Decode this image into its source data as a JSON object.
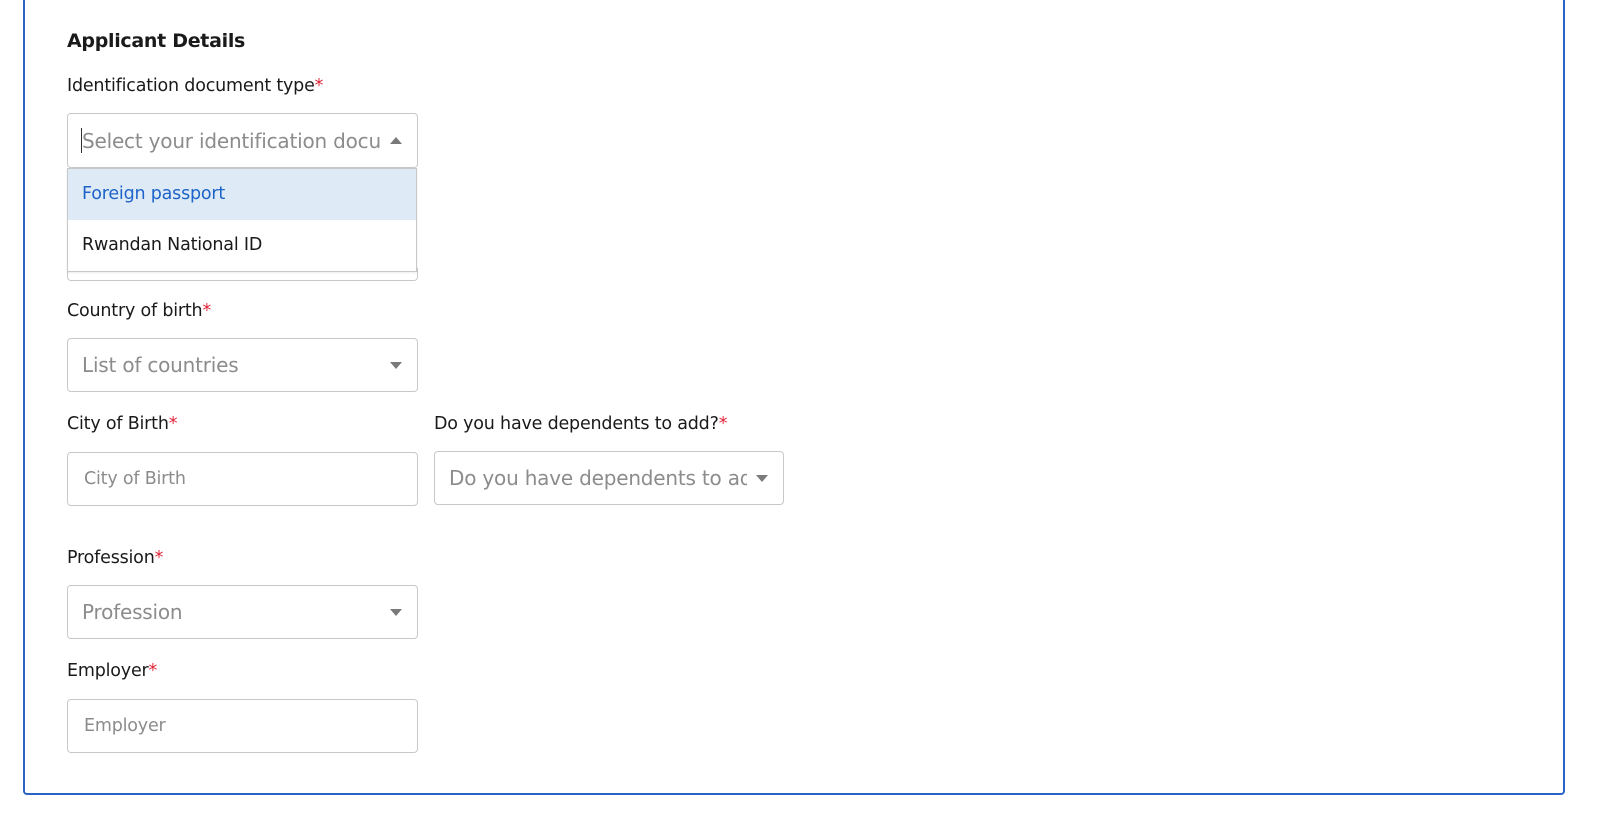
{
  "section": {
    "title": "Applicant Details"
  },
  "required_marker": "*",
  "id_doc": {
    "label": "Identification document type",
    "placeholder": "Select your identification docur",
    "options": [
      "Foreign passport",
      "Rwandan National ID"
    ],
    "highlighted_option": "Foreign passport"
  },
  "country_of_birth": {
    "label": "Country of birth",
    "placeholder": "List of countries"
  },
  "city_of_birth": {
    "label": "City of Birth",
    "placeholder": "City of Birth"
  },
  "dependents": {
    "label": "Do you have dependents to add?",
    "placeholder": "Do you have dependents to ad"
  },
  "profession": {
    "label": "Profession",
    "placeholder": "Profession"
  },
  "employer": {
    "label": "Employer",
    "placeholder": "Employer"
  },
  "colors": {
    "panel_border": "#2a63c4",
    "required": "#e0263a",
    "option_highlight_bg": "#deebf7",
    "option_highlight_text": "#1d63c8"
  },
  "icons": {
    "select_open": "caret-up-icon",
    "select_closed": "caret-down-icon"
  }
}
